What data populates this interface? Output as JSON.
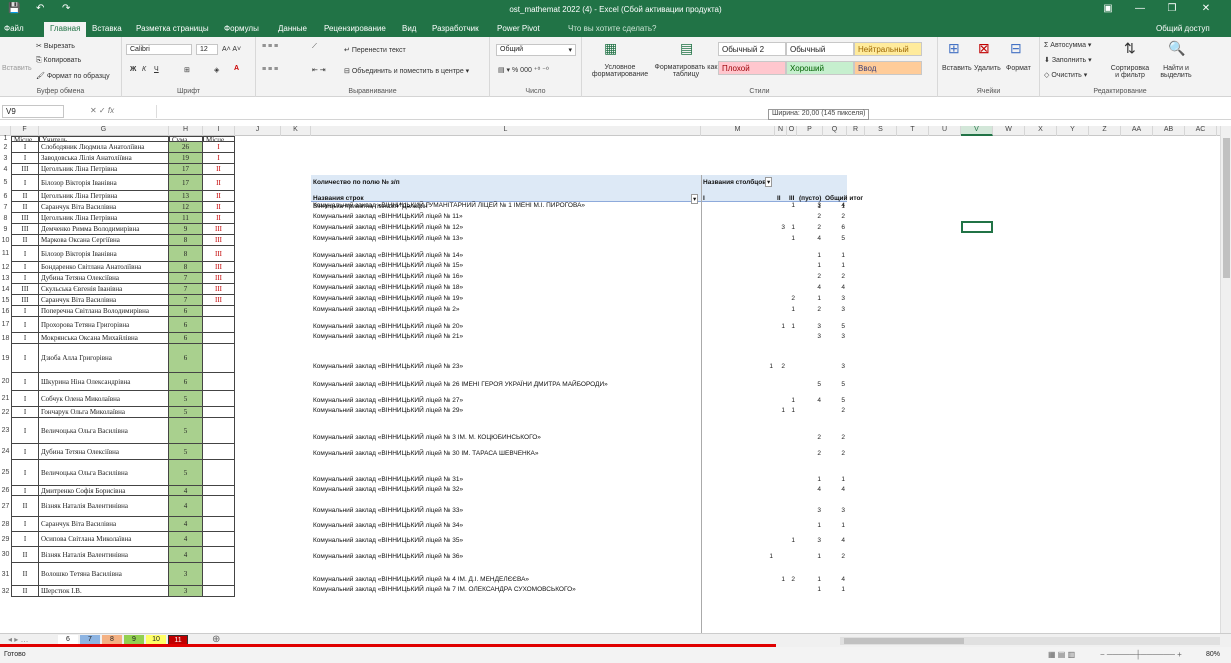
{
  "window": {
    "title": "ost_mathemat 2022 (4) - Excel (Сбой активации продукта)",
    "signin": "Общий доступ"
  },
  "ribbon_tabs": [
    "Файл",
    "Главная",
    "Вставка",
    "Разметка страницы",
    "Формулы",
    "Данные",
    "Рецензирование",
    "Вид",
    "Разработчик",
    "Power Pivot",
    "Что вы хотите сделать?"
  ],
  "clipboard": {
    "paste": "Вставить",
    "cut": "Вырезать",
    "copy": "Копировать",
    "format": "Формат по образцу",
    "label": "Буфер обмена"
  },
  "font": {
    "name": "Calibri",
    "size": "12",
    "label": "Шрифт"
  },
  "align": {
    "wrap": "Перенести текст",
    "merge": "Объединить и поместить в центре",
    "label": "Выравнивание"
  },
  "number": {
    "format": "Общий",
    "label": "Число"
  },
  "styles": {
    "cond": "Условное форматирование",
    "table": "Форматировать как таблицу",
    "items": [
      "Обычный 2",
      "Обычный",
      "Нейтральный",
      "Плохой",
      "Хороший",
      "Ввод"
    ],
    "label": "Стили"
  },
  "cells": {
    "insert": "Вставить",
    "delete": "Удалить",
    "format": "Формат",
    "label": "Ячейки"
  },
  "editing": {
    "autosum": "Автосумма",
    "fill": "Заполнить",
    "clear": "Очистить",
    "sort": "Сортировка и фильтр",
    "find": "Найти и выделить",
    "label": "Редактирование"
  },
  "formula_bar": {
    "cell": "V9",
    "fx": "fx",
    "value": ""
  },
  "width_tip": "Ширина: 20,00 (145 пикселя)",
  "columns": [
    "F",
    "G",
    "H",
    "I",
    "J",
    "K",
    "L",
    "M",
    "N",
    "O",
    "P",
    "Q",
    "R",
    "S",
    "T",
    "U",
    "V",
    "W",
    "X",
    "Y",
    "Z",
    "AA",
    "AB",
    "AC"
  ],
  "left_headers": {
    "f": "Місце",
    "g": "Учитель",
    "h": "Сума",
    "i": "Місце"
  },
  "left_rows": [
    {
      "f": "I",
      "g": "Слободяник Людмила Анатоліївна",
      "h": "26",
      "i": "I"
    },
    {
      "f": "I",
      "g": "Заводовська Лілія Анатоліївна",
      "h": "19",
      "i": "I"
    },
    {
      "f": "III",
      "g": "Цеголъник Ліна Петрівна",
      "h": "17",
      "i": "II"
    },
    {
      "f": "I",
      "g": "Білозор Вікторія Іванівна",
      "h": "17",
      "i": "II"
    },
    {
      "f": "II",
      "g": "Цеголъник Ліна Петрівна",
      "h": "13",
      "i": "II"
    },
    {
      "f": "II",
      "g": "Саранчук Віта Василівна",
      "h": "12",
      "i": "II"
    },
    {
      "f": "III",
      "g": "Цеголъник Ліна Петрівна",
      "h": "11",
      "i": "II"
    },
    {
      "f": "III",
      "g": "Демченко Римма Володимирівна",
      "h": "9",
      "i": "III"
    },
    {
      "f": "II",
      "g": "Маркова Оксана Сергіївна",
      "h": "8",
      "i": "III"
    },
    {
      "f": "I",
      "g": "Білозор Вікторія Іванівна",
      "h": "8",
      "i": "III"
    },
    {
      "f": "I",
      "g": "Бондаренко Світлана Анатоліївна",
      "h": "8",
      "i": "III"
    },
    {
      "f": "I",
      "g": "Дубина Тетяна Олексіївна",
      "h": "7",
      "i": "III"
    },
    {
      "f": "III",
      "g": "Скульська Євгенія Іванівна",
      "h": "7",
      "i": "III"
    },
    {
      "f": "III",
      "g": "Саранчук Віта Василівна",
      "h": "7",
      "i": "III"
    },
    {
      "f": "I",
      "g": "Поперечна Світлана Володимирівна",
      "h": "6",
      "i": ""
    },
    {
      "f": "I",
      "g": "Прохорова Тетяна Григорівна",
      "h": "6",
      "i": ""
    },
    {
      "f": "I",
      "g": "Мокрянська Оксана Михайлівна",
      "h": "6",
      "i": ""
    },
    {
      "f": "I",
      "g": "Дзюба Алла Григорівна",
      "h": "6",
      "i": ""
    },
    {
      "f": "I",
      "g": "Шкурина Ніна Олександрівна",
      "h": "6",
      "i": ""
    },
    {
      "f": "I",
      "g": "Собчук Олена Миколаївна",
      "h": "5",
      "i": ""
    },
    {
      "f": "I",
      "g": "Гончарук Ольга Миколаївна",
      "h": "5",
      "i": ""
    },
    {
      "f": "I",
      "g": "Величоцька Ольга Василівна",
      "h": "5",
      "i": ""
    },
    {
      "f": "I",
      "g": "Дубина Тетяна Олексіївна",
      "h": "5",
      "i": ""
    },
    {
      "f": "I",
      "g": "Величоцька Ольга Василівна",
      "h": "5",
      "i": ""
    },
    {
      "f": "I",
      "g": "Дмитренко Софія Борисівна",
      "h": "4",
      "i": ""
    },
    {
      "f": "II",
      "g": "Візняк Наталія Валентинівна",
      "h": "4",
      "i": ""
    },
    {
      "f": "I",
      "g": "Саранчук Віта Василівна",
      "h": "4",
      "i": ""
    },
    {
      "f": "I",
      "g": "Осипова Світлана Миколаївна",
      "h": "4",
      "i": ""
    },
    {
      "f": "II",
      "g": "Візняк Наталія Валентинівна",
      "h": "4",
      "i": ""
    },
    {
      "f": "II",
      "g": "Волошко Тетяна Василівна",
      "h": "3",
      "i": ""
    },
    {
      "f": "II",
      "g": "Шерстюк І.В.",
      "h": "3",
      "i": ""
    }
  ],
  "pivot": {
    "title": "Количество по полю № з/п",
    "col_field": "Названия столбцов",
    "row_field": "Названия строк",
    "col_labels": [
      "I",
      "II",
      "III",
      "(пусто)",
      "Общий итог"
    ]
  },
  "pivot_rows": [
    {
      "name": "Вінницька приватна гімназія \"Дельфін\"",
      "v": [
        "",
        "",
        "",
        "1",
        "1"
      ]
    },
    {
      "name": "Комунальний заклад «ВІННИЦЬКИЙ  ГУМАНІТАРНИЙ ЛІЦЕЙ № 1 ІМЕНІ М.І. ПИРОГОВА»",
      "v": [
        "",
        "",
        "1",
        "3",
        "4"
      ]
    },
    {
      "name": "Комунальний заклад «ВІННИЦЬКИЙ  ліцей  № 11»",
      "v": [
        "",
        "",
        "",
        "2",
        "2"
      ]
    },
    {
      "name": "Комунальний заклад «ВІННИЦЬКИЙ  ліцей  № 12»",
      "v": [
        "",
        "3",
        "1",
        "2",
        "6"
      ]
    },
    {
      "name": "Комунальний заклад «ВІННИЦЬКИЙ  ліцей  № 13»",
      "v": [
        "",
        "",
        "1",
        "4",
        "5"
      ]
    },
    {
      "name": "Комунальний заклад «ВІННИЦЬКИЙ  ліцей  № 14»",
      "v": [
        "",
        "",
        "",
        "1",
        "1"
      ]
    },
    {
      "name": "Комунальний заклад «ВІННИЦЬКИЙ  ліцей  № 15»",
      "v": [
        "",
        "",
        "",
        "1",
        "1"
      ]
    },
    {
      "name": "Комунальний заклад «ВІННИЦЬКИЙ  ліцей  № 16»",
      "v": [
        "",
        "",
        "",
        "2",
        "2"
      ]
    },
    {
      "name": "Комунальний заклад «ВІННИЦЬКИЙ  ліцей  № 18»",
      "v": [
        "",
        "",
        "",
        "4",
        "4"
      ]
    },
    {
      "name": "Комунальний заклад «ВІННИЦЬКИЙ  ліцей  № 19»",
      "v": [
        "",
        "",
        "2",
        "1",
        "3"
      ]
    },
    {
      "name": "Комунальний заклад «ВІННИЦЬКИЙ  ліцей  № 2»",
      "v": [
        "",
        "",
        "1",
        "2",
        "3"
      ]
    },
    {
      "name": "Комунальний заклад «ВІННИЦЬКИЙ  ліцей  № 20»",
      "v": [
        "",
        "1",
        "1",
        "3",
        "5"
      ]
    },
    {
      "name": "Комунальний заклад «ВІННИЦЬКИЙ  ліцей  № 21»",
      "v": [
        "",
        "",
        "",
        "3",
        "3"
      ]
    },
    {
      "name": "Комунальний заклад «ВІННИЦЬКИЙ  ліцей  № 23»",
      "v": [
        "1",
        "2",
        "",
        "",
        "3"
      ]
    },
    {
      "name": "Комунальний заклад «ВІННИЦЬКИЙ  ліцей  № 26 ІМЕНІ ГЕРОЯ УКРАЇНИ ДМИТРА МАЙБОРОДИ»",
      "v": [
        "",
        "",
        "",
        "5",
        "5"
      ]
    },
    {
      "name": "Комунальний заклад «ВІННИЦЬКИЙ  ліцей  № 27»",
      "v": [
        "",
        "",
        "1",
        "4",
        "5"
      ]
    },
    {
      "name": "Комунальний заклад «ВІННИЦЬКИЙ  ліцей  № 29»",
      "v": [
        "",
        "1",
        "1",
        "",
        "2"
      ]
    },
    {
      "name": "Комунальний заклад «ВІННИЦЬКИЙ  ліцей  № 3 ІМ. М. КОЦЮБИНСЬКОГО»",
      "v": [
        "",
        "",
        "",
        "2",
        "2"
      ]
    },
    {
      "name": "Комунальний заклад «ВІННИЦЬКИЙ  ліцей  № 30  ІМ. ТАРАСА ШЕВЧЕНКА»",
      "v": [
        "",
        "",
        "",
        "2",
        "2"
      ]
    },
    {
      "name": "Комунальний заклад «ВІННИЦЬКИЙ  ліцей  № 31»",
      "v": [
        "",
        "",
        "",
        "1",
        "1"
      ]
    },
    {
      "name": "Комунальний заклад «ВІННИЦЬКИЙ  ліцей  № 32»",
      "v": [
        "",
        "",
        "",
        "4",
        "4"
      ]
    },
    {
      "name": "Комунальний заклад «ВІННИЦЬКИЙ  ліцей  № 33»",
      "v": [
        "",
        "",
        "",
        "3",
        "3"
      ]
    },
    {
      "name": "Комунальний заклад «ВІННИЦЬКИЙ  ліцей  № 34»",
      "v": [
        "",
        "",
        "",
        "1",
        "1"
      ]
    },
    {
      "name": "Комунальний заклад «ВІННИЦЬКИЙ  ліцей  № 35»",
      "v": [
        "",
        "",
        "1",
        "3",
        "4"
      ]
    },
    {
      "name": "Комунальний заклад «ВІННИЦЬКИЙ  ліцей  № 36»",
      "v": [
        "1",
        "",
        "",
        "1",
        "2"
      ]
    },
    {
      "name": "Комунальний заклад «ВІННИЦЬКИЙ  ліцей  № 4 ІМ. Д.І. МЕНДЕЛЄЄВА»",
      "v": [
        "",
        "1",
        "2",
        "1",
        "4"
      ]
    },
    {
      "name": "Комунальний заклад «ВІННИЦЬКИЙ  ліцей  № 7 ІМ. ОЛЕКСАНДРА СУХОМОВСЬКОГО»",
      "v": [
        "",
        "",
        "",
        "1",
        "1"
      ]
    }
  ],
  "sheet_tabs": [
    {
      "label": "6",
      "color": "#ffffff"
    },
    {
      "label": "7",
      "color": "#8db4e2"
    },
    {
      "label": "8",
      "color": "#f4b183"
    },
    {
      "label": "9",
      "color": "#92d050"
    },
    {
      "label": "10",
      "color": "#ffff66"
    },
    {
      "label": "11",
      "color": "#c00000"
    }
  ],
  "status": {
    "ready": "Готово",
    "zoom": "80%"
  }
}
